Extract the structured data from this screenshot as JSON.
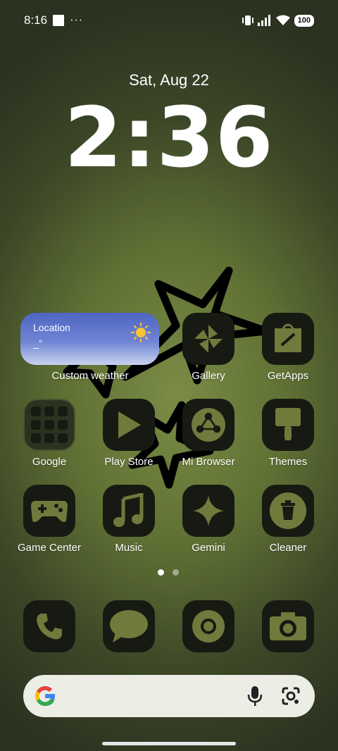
{
  "status_bar": {
    "time": "8:16",
    "overflow": "···",
    "battery": "100"
  },
  "lock": {
    "date": "Sat, Aug 22",
    "time": "2:36"
  },
  "weather_widget": {
    "location": "Location",
    "temperature": "_°",
    "label": "Custom weather"
  },
  "apps": [
    {
      "label": "Gallery",
      "icon": "gallery-icon"
    },
    {
      "label": "GetApps",
      "icon": "getapps-icon"
    },
    {
      "label": "Google",
      "icon": "google-folder-icon"
    },
    {
      "label": "Play Store",
      "icon": "play-store-icon"
    },
    {
      "label": "Mi Browser",
      "icon": "mi-browser-icon"
    },
    {
      "label": "Themes",
      "icon": "themes-icon"
    },
    {
      "label": "Game Center",
      "icon": "game-center-icon"
    },
    {
      "label": "Music",
      "icon": "music-icon"
    },
    {
      "label": "Gemini",
      "icon": "gemini-icon"
    },
    {
      "label": "Cleaner",
      "icon": "cleaner-icon"
    }
  ],
  "dock": [
    "phone-icon",
    "messages-icon",
    "chrome-icon",
    "camera-icon"
  ],
  "pager": {
    "pages": 2,
    "current": 1
  },
  "colors": {
    "icon_bg": "#171a12",
    "icon_fg": "#6f7a3c",
    "wall_light": "#7a8c46",
    "wall_dark": "#2b3220"
  }
}
